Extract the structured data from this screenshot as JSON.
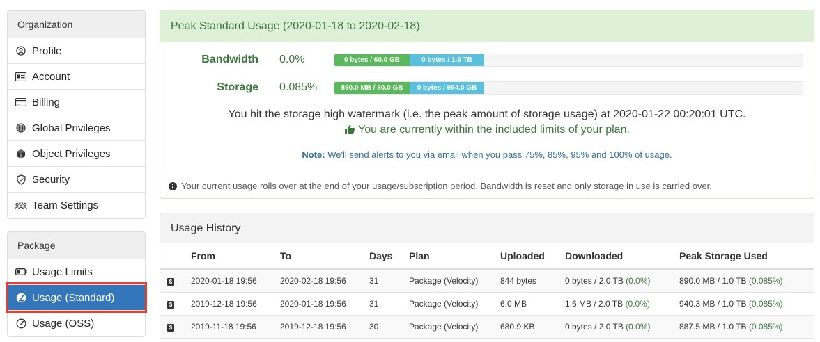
{
  "sidebar": {
    "organization": {
      "heading": "Organization",
      "items": [
        {
          "label": "Profile",
          "icon": "user-circle-icon"
        },
        {
          "label": "Account",
          "icon": "id-card-icon"
        },
        {
          "label": "Billing",
          "icon": "credit-card-icon"
        },
        {
          "label": "Global Privileges",
          "icon": "globe-icon"
        },
        {
          "label": "Object Privileges",
          "icon": "cube-icon"
        },
        {
          "label": "Security",
          "icon": "shield-icon"
        },
        {
          "label": "Team Settings",
          "icon": "users-icon"
        }
      ]
    },
    "package": {
      "heading": "Package",
      "items": [
        {
          "label": "Usage Limits",
          "icon": "battery-icon"
        },
        {
          "label": "Usage (Standard)",
          "icon": "gauge-icon",
          "active": true
        },
        {
          "label": "Usage (OSS)",
          "icon": "gauge-outline-icon"
        }
      ]
    }
  },
  "peak": {
    "title": "Peak Standard Usage (2020-01-18 to 2020-02-18)",
    "bandwidth": {
      "label": "Bandwidth",
      "percent": "0.0%",
      "seg1": "0 bytes / 60.0 GB",
      "seg2": "0 bytes / 1.9 TB"
    },
    "storage": {
      "label": "Storage",
      "percent": "0.085%",
      "seg1": "890.0 MB / 30.0 GB",
      "seg2": "0 bytes / 994.0 GB"
    },
    "watermark": "You hit the storage high watermark (i.e. the peak amount of storage usage) at 2020-01-22 00:20:01 UTC.",
    "within": "You are currently within the included limits of your plan.",
    "note_label": "Note:",
    "note_text": "We'll send alerts to you via email when you pass 75%, 85%, 95% and 100% of usage.",
    "footer": "Your current usage rolls over at the end of your usage/subscription period. Bandwidth is reset and only storage in use is carried over."
  },
  "history": {
    "title": "Usage History",
    "columns": [
      "From",
      "To",
      "Days",
      "Plan",
      "Uploaded",
      "Downloaded",
      "Peak Storage Used"
    ],
    "rows": [
      {
        "from": "2020-01-18 19:56",
        "to": "2020-02-18 19:56",
        "days": "31",
        "plan": "Package (Velocity)",
        "uploaded": "844 bytes",
        "downloaded": "0 bytes / 2.0 TB",
        "downloaded_pct": "(0.0%)",
        "peak": "890.0 MB / 1.0 TB",
        "peak_pct": "(0.085%)"
      },
      {
        "from": "2019-12-18 19:56",
        "to": "2020-01-18 19:56",
        "days": "31",
        "plan": "Package (Velocity)",
        "uploaded": "6.0 MB",
        "downloaded": "1.6 MB / 2.0 TB",
        "downloaded_pct": "(0.0%)",
        "peak": "940.3 MB / 1.0 TB",
        "peak_pct": "(0.085%)"
      },
      {
        "from": "2019-11-18 19:56",
        "to": "2019-12-18 19:56",
        "days": "30",
        "plan": "Package (Velocity)",
        "uploaded": "680.9 KB",
        "downloaded": "0 bytes / 2.0 TB",
        "downloaded_pct": "(0.0%)",
        "peak": "887.5 MB / 1.0 TB",
        "peak_pct": "(0.085%)"
      }
    ]
  },
  "colors": {
    "active_nav": "#3376ba",
    "highlight_outline": "#e64029",
    "success": "#3c763d",
    "bar_green": "#5cb85c",
    "bar_blue": "#5bc0de"
  }
}
